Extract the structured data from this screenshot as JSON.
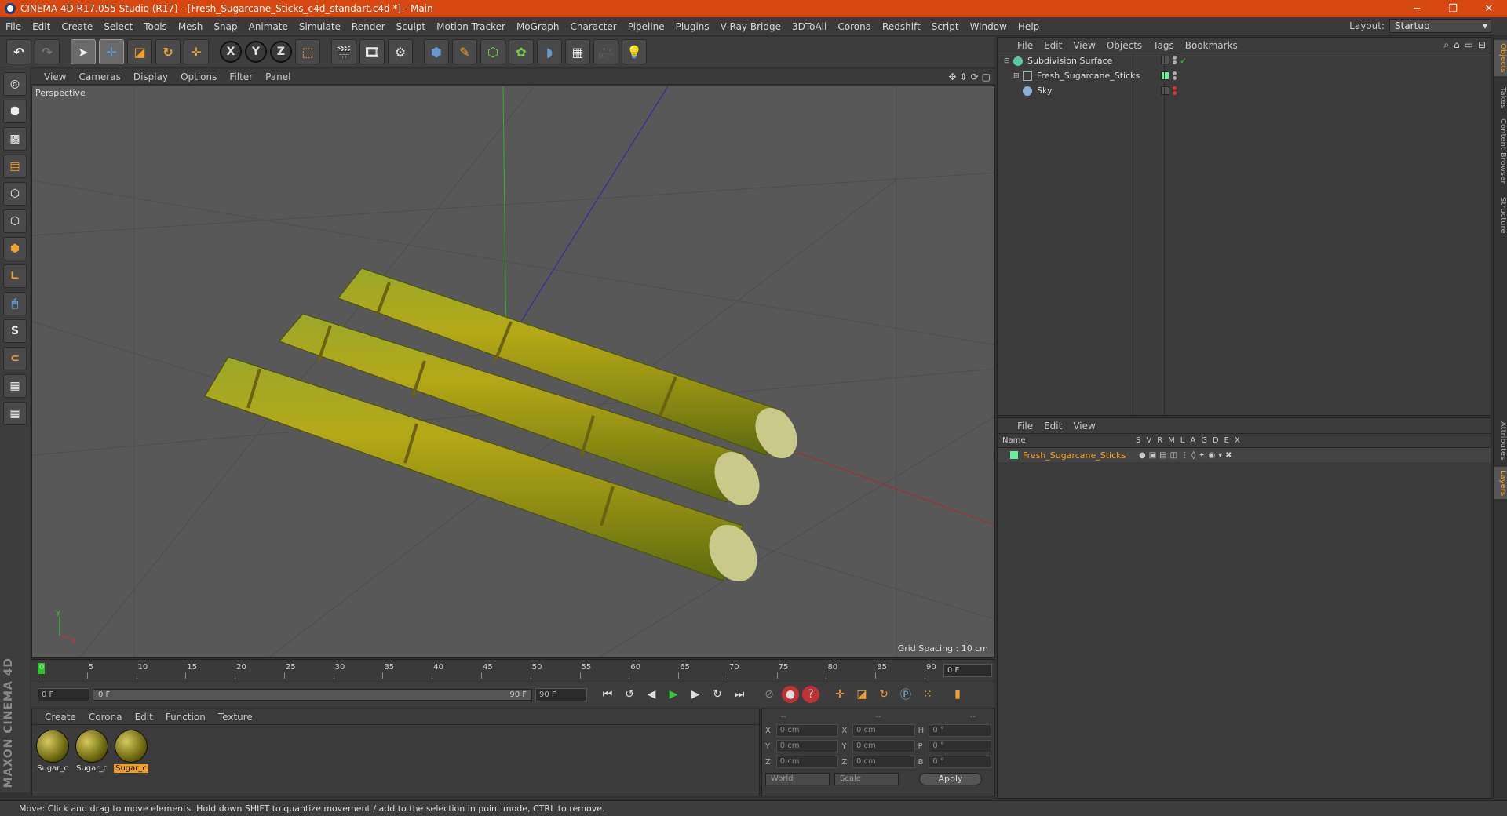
{
  "window": {
    "title": "CINEMA 4D R17.055 Studio (R17) - [Fresh_Sugarcane_Sticks_c4d_standart.c4d *] - Main",
    "controls": [
      "─",
      "❐",
      "✕"
    ]
  },
  "menubar": {
    "items": [
      "File",
      "Edit",
      "Create",
      "Select",
      "Tools",
      "Mesh",
      "Snap",
      "Animate",
      "Simulate",
      "Render",
      "Sculpt",
      "Motion Tracker",
      "MoGraph",
      "Character",
      "Pipeline",
      "Plugins",
      "V-Ray Bridge",
      "3DToAll",
      "Corona",
      "Redshift",
      "Script",
      "Window",
      "Help"
    ],
    "layout_label": "Layout:",
    "layout_value": "Startup"
  },
  "toolbar": {
    "axis_x": "X",
    "axis_y": "Y",
    "axis_z": "Z"
  },
  "viewport": {
    "menu": [
      "View",
      "Cameras",
      "Display",
      "Options",
      "Filter",
      "Panel"
    ],
    "label": "Perspective",
    "grid_spacing": "Grid Spacing : 10 cm",
    "axis_y": "Y",
    "axis_x": "X"
  },
  "timeline": {
    "ticks": [
      "0",
      "5",
      "10",
      "15",
      "20",
      "25",
      "30",
      "35",
      "40",
      "45",
      "50",
      "55",
      "60",
      "65",
      "70",
      "75",
      "80",
      "85",
      "90"
    ],
    "current_frame": "0 F"
  },
  "transport": {
    "start": "0 F",
    "range_start": "0 F",
    "range_end": "90 F",
    "end": "90 F"
  },
  "material_manager": {
    "menu": [
      "Create",
      "Corona",
      "Edit",
      "Function",
      "Texture"
    ],
    "materials": [
      {
        "name": "Sugar_c",
        "selected": false
      },
      {
        "name": "Sugar_c",
        "selected": false
      },
      {
        "name": "Sugar_c",
        "selected": true
      }
    ]
  },
  "coordinates": {
    "headers": [
      "--",
      "--",
      "--"
    ],
    "rows": [
      {
        "a1": "X",
        "v1": "0 cm",
        "a2": "X",
        "v2": "0 cm",
        "a3": "H",
        "v3": "0 °"
      },
      {
        "a1": "Y",
        "v1": "0 cm",
        "a2": "Y",
        "v2": "0 cm",
        "a3": "P",
        "v3": "0 °"
      },
      {
        "a1": "Z",
        "v1": "0 cm",
        "a2": "Z",
        "v2": "0 cm",
        "a3": "B",
        "v3": "0 °"
      }
    ],
    "mode1": "World",
    "mode2": "Scale",
    "apply": "Apply"
  },
  "objects": {
    "menu": [
      "File",
      "Edit",
      "View",
      "Objects",
      "Tags",
      "Bookmarks"
    ],
    "items": [
      {
        "name": "Subdivision Surface",
        "icon_color": "#5fc8a0"
      },
      {
        "name": "Fresh_Sugarcane_Sticks",
        "icon_color": "#9ab"
      },
      {
        "name": "Sky",
        "icon_color": "#8ab0d8"
      }
    ]
  },
  "layers": {
    "menu": [
      "File",
      "Edit",
      "View"
    ],
    "col_name": "Name",
    "col_flags": [
      "S",
      "V",
      "R",
      "M",
      "L",
      "A",
      "G",
      "D",
      "E",
      "X"
    ],
    "item": "Fresh_Sugarcane_Sticks"
  },
  "sidetabs": [
    "Objects",
    "Takes",
    "Content Browser",
    "Structure",
    "Attributes",
    "Layers"
  ],
  "status": "Move: Click and drag to move elements. Hold down SHIFT to quantize movement / add to the selection in point mode, CTRL to remove.",
  "brand": "MAXON CINEMA 4D"
}
